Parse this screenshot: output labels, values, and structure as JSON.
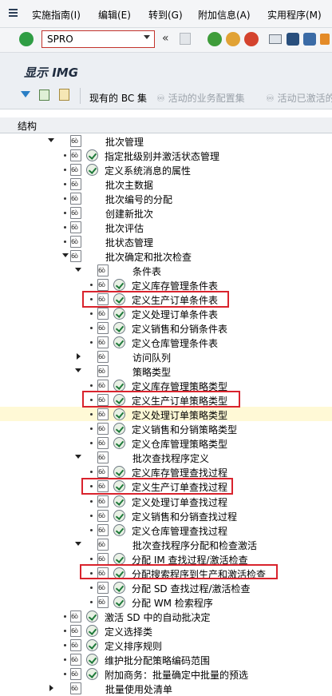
{
  "menubar": {
    "items": [
      "实施指南(I)",
      "编辑(E)",
      "转到(G)",
      "附加信息(A)",
      "实用程序(M)"
    ]
  },
  "toolbar": {
    "command_value": "SPRO"
  },
  "screen": {
    "title": "显示 IMG"
  },
  "appbar": {
    "current_bc_sets": "现有的 BC 集",
    "activated_business_config": "活动的业务配置集",
    "activated_bc_sets": "活动已激活的"
  },
  "tree": {
    "header": "结构",
    "rows": [
      {
        "label": "批次管理"
      },
      {
        "label": "指定批级别并激活状态管理"
      },
      {
        "label": "定义系统消息的属性"
      },
      {
        "label": "批次主数据"
      },
      {
        "label": "批次编号的分配"
      },
      {
        "label": "创建新批次"
      },
      {
        "label": "批次评估"
      },
      {
        "label": "批状态管理"
      },
      {
        "label": "批次确定和批次检查"
      },
      {
        "label": "条件表"
      },
      {
        "label": "定义库存管理条件表"
      },
      {
        "label": "定义生产订单条件表"
      },
      {
        "label": "定义处理订单条件表"
      },
      {
        "label": "定义销售和分销条件表"
      },
      {
        "label": "定义仓库管理条件表"
      },
      {
        "label": "访问队列"
      },
      {
        "label": "策略类型"
      },
      {
        "label": "定义库存管理策略类型"
      },
      {
        "label": "定义生产订单策略类型"
      },
      {
        "label": "定义处理订单策略类型"
      },
      {
        "label": "定义销售和分销策略类型"
      },
      {
        "label": "定义仓库管理策略类型"
      },
      {
        "label": "批次查找程序定义"
      },
      {
        "label": "定义库存管理查找过程"
      },
      {
        "label": "定义生产订单查找过程"
      },
      {
        "label": "定义处理订单查找过程"
      },
      {
        "label": "定义销售和分销查找过程"
      },
      {
        "label": "定义仓库管理查找过程"
      },
      {
        "label": "批次查找程序分配和检查激活"
      },
      {
        "label": "分配 IM 查找过程/激活检查"
      },
      {
        "label": "分配搜索程序到生产和激活检查"
      },
      {
        "label": "分配 SD 查找过程/激活检查"
      },
      {
        "label": "分配 WM 检索程序"
      },
      {
        "label": "激活 SD 中的自动批决定"
      },
      {
        "label": "定义选择类"
      },
      {
        "label": "定义排序规则"
      },
      {
        "label": "维护批分配策略编码范围"
      },
      {
        "label": "附加商务：批量确定中批量的预选"
      },
      {
        "label": "批量使用处清单"
      }
    ]
  }
}
